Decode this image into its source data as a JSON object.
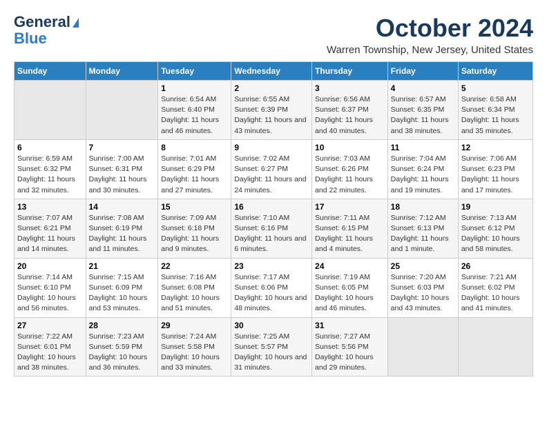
{
  "header": {
    "logo_line1": "General",
    "logo_line2": "Blue",
    "main_title": "October 2024",
    "subtitle": "Warren Township, New Jersey, United States"
  },
  "days_of_week": [
    "Sunday",
    "Monday",
    "Tuesday",
    "Wednesday",
    "Thursday",
    "Friday",
    "Saturday"
  ],
  "weeks": [
    [
      {
        "day": "",
        "info": ""
      },
      {
        "day": "",
        "info": ""
      },
      {
        "day": "1",
        "info": "Sunrise: 6:54 AM\nSunset: 6:40 PM\nDaylight: 11 hours and 46 minutes."
      },
      {
        "day": "2",
        "info": "Sunrise: 6:55 AM\nSunset: 6:39 PM\nDaylight: 11 hours and 43 minutes."
      },
      {
        "day": "3",
        "info": "Sunrise: 6:56 AM\nSunset: 6:37 PM\nDaylight: 11 hours and 40 minutes."
      },
      {
        "day": "4",
        "info": "Sunrise: 6:57 AM\nSunset: 6:35 PM\nDaylight: 11 hours and 38 minutes."
      },
      {
        "day": "5",
        "info": "Sunrise: 6:58 AM\nSunset: 6:34 PM\nDaylight: 11 hours and 35 minutes."
      }
    ],
    [
      {
        "day": "6",
        "info": "Sunrise: 6:59 AM\nSunset: 6:32 PM\nDaylight: 11 hours and 32 minutes."
      },
      {
        "day": "7",
        "info": "Sunrise: 7:00 AM\nSunset: 6:31 PM\nDaylight: 11 hours and 30 minutes."
      },
      {
        "day": "8",
        "info": "Sunrise: 7:01 AM\nSunset: 6:29 PM\nDaylight: 11 hours and 27 minutes."
      },
      {
        "day": "9",
        "info": "Sunrise: 7:02 AM\nSunset: 6:27 PM\nDaylight: 11 hours and 24 minutes."
      },
      {
        "day": "10",
        "info": "Sunrise: 7:03 AM\nSunset: 6:26 PM\nDaylight: 11 hours and 22 minutes."
      },
      {
        "day": "11",
        "info": "Sunrise: 7:04 AM\nSunset: 6:24 PM\nDaylight: 11 hours and 19 minutes."
      },
      {
        "day": "12",
        "info": "Sunrise: 7:06 AM\nSunset: 6:23 PM\nDaylight: 11 hours and 17 minutes."
      }
    ],
    [
      {
        "day": "13",
        "info": "Sunrise: 7:07 AM\nSunset: 6:21 PM\nDaylight: 11 hours and 14 minutes."
      },
      {
        "day": "14",
        "info": "Sunrise: 7:08 AM\nSunset: 6:19 PM\nDaylight: 11 hours and 11 minutes."
      },
      {
        "day": "15",
        "info": "Sunrise: 7:09 AM\nSunset: 6:18 PM\nDaylight: 11 hours and 9 minutes."
      },
      {
        "day": "16",
        "info": "Sunrise: 7:10 AM\nSunset: 6:16 PM\nDaylight: 11 hours and 6 minutes."
      },
      {
        "day": "17",
        "info": "Sunrise: 7:11 AM\nSunset: 6:15 PM\nDaylight: 11 hours and 4 minutes."
      },
      {
        "day": "18",
        "info": "Sunrise: 7:12 AM\nSunset: 6:13 PM\nDaylight: 11 hours and 1 minute."
      },
      {
        "day": "19",
        "info": "Sunrise: 7:13 AM\nSunset: 6:12 PM\nDaylight: 10 hours and 58 minutes."
      }
    ],
    [
      {
        "day": "20",
        "info": "Sunrise: 7:14 AM\nSunset: 6:10 PM\nDaylight: 10 hours and 56 minutes."
      },
      {
        "day": "21",
        "info": "Sunrise: 7:15 AM\nSunset: 6:09 PM\nDaylight: 10 hours and 53 minutes."
      },
      {
        "day": "22",
        "info": "Sunrise: 7:16 AM\nSunset: 6:08 PM\nDaylight: 10 hours and 51 minutes."
      },
      {
        "day": "23",
        "info": "Sunrise: 7:17 AM\nSunset: 6:06 PM\nDaylight: 10 hours and 48 minutes."
      },
      {
        "day": "24",
        "info": "Sunrise: 7:19 AM\nSunset: 6:05 PM\nDaylight: 10 hours and 46 minutes."
      },
      {
        "day": "25",
        "info": "Sunrise: 7:20 AM\nSunset: 6:03 PM\nDaylight: 10 hours and 43 minutes."
      },
      {
        "day": "26",
        "info": "Sunrise: 7:21 AM\nSunset: 6:02 PM\nDaylight: 10 hours and 41 minutes."
      }
    ],
    [
      {
        "day": "27",
        "info": "Sunrise: 7:22 AM\nSunset: 6:01 PM\nDaylight: 10 hours and 38 minutes."
      },
      {
        "day": "28",
        "info": "Sunrise: 7:23 AM\nSunset: 5:59 PM\nDaylight: 10 hours and 36 minutes."
      },
      {
        "day": "29",
        "info": "Sunrise: 7:24 AM\nSunset: 5:58 PM\nDaylight: 10 hours and 33 minutes."
      },
      {
        "day": "30",
        "info": "Sunrise: 7:25 AM\nSunset: 5:57 PM\nDaylight: 10 hours and 31 minutes."
      },
      {
        "day": "31",
        "info": "Sunrise: 7:27 AM\nSunset: 5:56 PM\nDaylight: 10 hours and 29 minutes."
      },
      {
        "day": "",
        "info": ""
      },
      {
        "day": "",
        "info": ""
      }
    ]
  ]
}
